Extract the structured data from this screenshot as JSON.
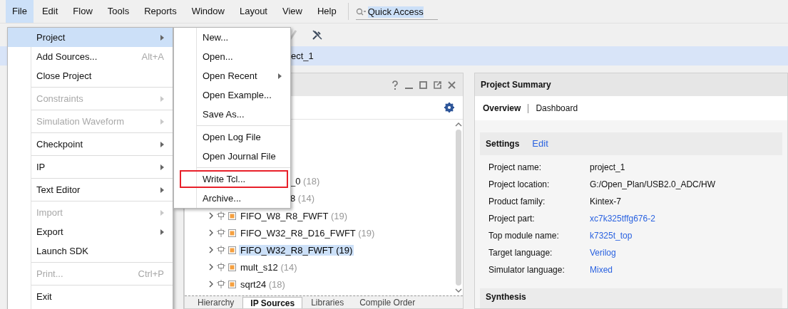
{
  "menubar": [
    {
      "label": "File",
      "selected": true
    },
    {
      "label": "Edit",
      "selected": false
    },
    {
      "label": "Flow",
      "selected": false
    },
    {
      "label": "Tools",
      "selected": false
    },
    {
      "label": "Reports",
      "selected": false
    },
    {
      "label": "Window",
      "selected": false
    },
    {
      "label": "Layout",
      "selected": false
    },
    {
      "label": "View",
      "selected": false
    },
    {
      "label": "Help",
      "selected": false
    }
  ],
  "quick_access": {
    "value": "Quick Access"
  },
  "project_bar": {
    "title": "ect_1"
  },
  "sources_panel": {
    "tree": [
      {
        "kind": "partial",
        "name": "_0",
        "count": "(18)"
      },
      {
        "kind": "partial",
        "name": "8",
        "count": "(14)"
      },
      {
        "kind": "ip",
        "name": "FIFO_W8_R8_FWFT",
        "count": "(19)",
        "selected": false
      },
      {
        "kind": "ip",
        "name": "FIFO_W32_R8_D16_FWFT",
        "count": "(19)",
        "selected": false
      },
      {
        "kind": "ip",
        "name": "FIFO_W32_R8_FWFT",
        "count": "(19)",
        "selected": true
      },
      {
        "kind": "ip",
        "name": "mult_s12",
        "count": "(14)",
        "selected": false
      },
      {
        "kind": "ip",
        "name": "sqrt24",
        "count": "(18)",
        "selected": false
      }
    ],
    "tabs": [
      {
        "label": "Hierarchy",
        "selected": false
      },
      {
        "label": "IP Sources",
        "selected": true
      },
      {
        "label": "Libraries",
        "selected": false
      },
      {
        "label": "Compile Order",
        "selected": false
      }
    ]
  },
  "summary": {
    "title": "Project Summary",
    "tabs": [
      {
        "label": "Overview",
        "selected": true
      },
      {
        "label": "Dashboard",
        "selected": false
      }
    ],
    "settings": {
      "title": "Settings",
      "edit": "Edit",
      "rows": [
        {
          "label": "Project name:",
          "value": "project_1",
          "kind": "text"
        },
        {
          "label": "Project location:",
          "value": "G:/Open_Plan/USB2.0_ADC/HW",
          "kind": "text"
        },
        {
          "label": "Product family:",
          "value": "Kintex-7",
          "kind": "text"
        },
        {
          "label": "Project part:",
          "value": "xc7k325tffg676-2",
          "kind": "link"
        },
        {
          "label": "Top module name:",
          "value": "k7325t_top",
          "kind": "link"
        },
        {
          "label": "Target language:",
          "value": "Verilog",
          "kind": "link"
        },
        {
          "label": "Simulator language:",
          "value": "Mixed",
          "kind": "link"
        }
      ]
    },
    "next_section": "Synthesis"
  },
  "file_menu": [
    {
      "kind": "item",
      "label": "Project",
      "submenu": true,
      "disabled": false,
      "selected": true
    },
    {
      "kind": "item",
      "label": "Add Sources...",
      "shortcut": "Alt+A",
      "submenu": false,
      "disabled": false,
      "selected": false
    },
    {
      "kind": "item",
      "label": "Close Project",
      "submenu": false,
      "disabled": false,
      "selected": false
    },
    {
      "kind": "separator"
    },
    {
      "kind": "item",
      "label": "Constraints",
      "submenu": true,
      "disabled": true,
      "selected": false
    },
    {
      "kind": "separator"
    },
    {
      "kind": "item",
      "label": "Simulation Waveform",
      "submenu": true,
      "disabled": true,
      "selected": false
    },
    {
      "kind": "separator"
    },
    {
      "kind": "item",
      "label": "Checkpoint",
      "submenu": true,
      "disabled": false,
      "selected": false
    },
    {
      "kind": "separator"
    },
    {
      "kind": "item",
      "label": "IP",
      "submenu": true,
      "disabled": false,
      "selected": false
    },
    {
      "kind": "separator"
    },
    {
      "kind": "item",
      "label": "Text Editor",
      "submenu": true,
      "disabled": false,
      "selected": false
    },
    {
      "kind": "separator"
    },
    {
      "kind": "item",
      "label": "Import",
      "submenu": true,
      "disabled": true,
      "selected": false
    },
    {
      "kind": "item",
      "label": "Export",
      "submenu": true,
      "disabled": false,
      "selected": false
    },
    {
      "kind": "item",
      "label": "Launch SDK",
      "submenu": false,
      "disabled": false,
      "selected": false
    },
    {
      "kind": "separator"
    },
    {
      "kind": "item",
      "label": "Print...",
      "shortcut": "Ctrl+P",
      "submenu": false,
      "disabled": true,
      "selected": false
    },
    {
      "kind": "separator"
    },
    {
      "kind": "item",
      "label": "Exit",
      "submenu": false,
      "disabled": false,
      "selected": false
    }
  ],
  "project_submenu": [
    {
      "kind": "item",
      "label": "New...",
      "submenu": false,
      "annotated": false
    },
    {
      "kind": "item",
      "label": "Open...",
      "submenu": false,
      "annotated": false
    },
    {
      "kind": "item",
      "label": "Open Recent",
      "submenu": true,
      "annotated": false
    },
    {
      "kind": "item",
      "label": "Open Example...",
      "submenu": false,
      "annotated": false
    },
    {
      "kind": "item",
      "label": "Save As...",
      "submenu": false,
      "annotated": false
    },
    {
      "kind": "separator"
    },
    {
      "kind": "item",
      "label": "Open Log File",
      "submenu": false,
      "annotated": false
    },
    {
      "kind": "item",
      "label": "Open Journal File",
      "submenu": false,
      "annotated": false
    },
    {
      "kind": "separator"
    },
    {
      "kind": "item",
      "label": "Write Tcl...",
      "submenu": false,
      "annotated": true
    },
    {
      "kind": "item",
      "label": "Archive...",
      "submenu": false,
      "annotated": false
    }
  ]
}
